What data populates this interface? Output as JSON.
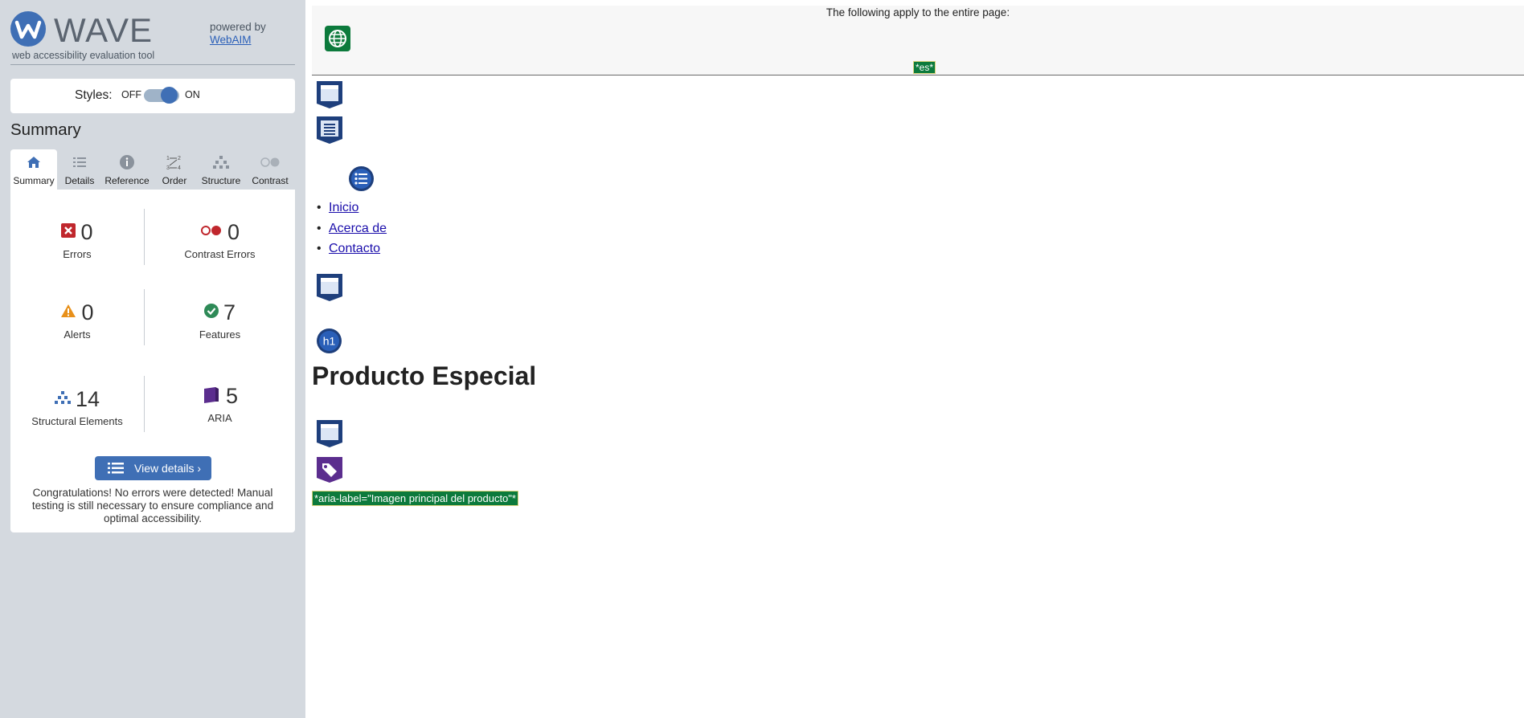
{
  "sidebar": {
    "logo": {
      "word": "WAVE",
      "tagline": "web accessibility evaluation tool"
    },
    "powered_by": {
      "text": "powered by",
      "link": "WebAIM"
    },
    "styles": {
      "label": "Styles:",
      "off": "OFF",
      "on": "ON",
      "state": "on"
    },
    "summary_title": "Summary",
    "tabs": [
      {
        "label": "Summary",
        "icon": "home-icon",
        "active": true
      },
      {
        "label": "Details",
        "icon": "list-icon"
      },
      {
        "label": "Reference",
        "icon": "info-icon"
      },
      {
        "label": "Order",
        "icon": "order-icon"
      },
      {
        "label": "Structure",
        "icon": "structure-icon"
      },
      {
        "label": "Contrast",
        "icon": "contrast-icon"
      }
    ],
    "stats": {
      "errors": {
        "value": "0",
        "label": "Errors"
      },
      "contrast_errors": {
        "value": "0",
        "label": "Contrast Errors"
      },
      "alerts": {
        "value": "0",
        "label": "Alerts"
      },
      "features": {
        "value": "7",
        "label": "Features"
      },
      "structural": {
        "value": "14",
        "label": "Structural Elements"
      },
      "aria": {
        "value": "5",
        "label": "ARIA"
      }
    },
    "view_details": "View details ›",
    "congrats": "Congratulations! No errors were detected! Manual testing is still necessary to ensure compliance and optimal accessibility."
  },
  "main": {
    "banner_text": "The following apply to the entire page:",
    "lang_badge": "*es*",
    "nav_links": [
      "Inicio",
      "Acerca de",
      "Contacto"
    ],
    "heading_icon": "h1",
    "heading": "Producto Especial",
    "aria_label_badge": "*aria-label=\"Imagen principal del producto\"*"
  },
  "colors": {
    "sidebar_bg": "#d4d9df",
    "accent": "#3f6fb5",
    "feature_green": "#0c7a3c",
    "structure_navy": "#1e3f7c",
    "aria_purple": "#5b2d8e"
  }
}
